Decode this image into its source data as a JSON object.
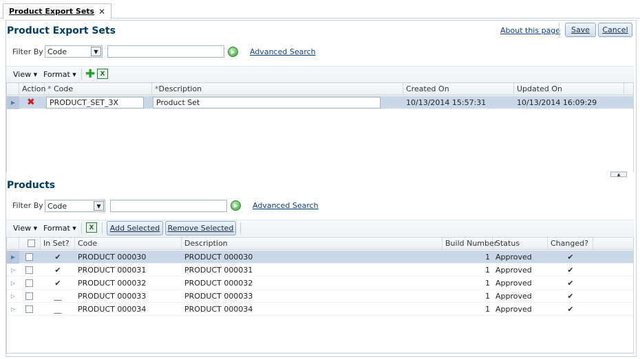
{
  "tab": {
    "label": "Product Export Sets",
    "close": "✕"
  },
  "header": {
    "title": "Product Export Sets",
    "about_link": "About this page",
    "save_label": "Save",
    "cancel_label": "Cancel"
  },
  "filter1": {
    "label": "Filter By",
    "field": "Code",
    "search_value": "",
    "advanced_search": "Advanced Search"
  },
  "toolbar1": {
    "view": "View ▾",
    "format": "Format ▾"
  },
  "export_sets_grid": {
    "columns": [
      "Action",
      "Code",
      "Description",
      "Created On",
      "Updated On"
    ],
    "required_marker": "*",
    "rows": [
      {
        "code": "PRODUCT_SET_3X",
        "description": "Product Set",
        "created_on": "10/13/2014 15:57:31",
        "updated_on": "10/13/2014 16:09:29"
      }
    ]
  },
  "products": {
    "title": "Products",
    "filter": {
      "label": "Filter By",
      "field": "Code",
      "search_value": "",
      "advanced_search": "Advanced Search"
    },
    "toolbar": {
      "view": "View ▾",
      "format": "Format ▾",
      "add_selected": "Add Selected",
      "remove_selected": "Remove Selected"
    },
    "columns": [
      "In Set?",
      "Code",
      "Description",
      "Build Number",
      "Status",
      "Changed?"
    ],
    "rows": [
      {
        "in_set": "✔",
        "code": "PRODUCT 000030",
        "description": "PRODUCT 000030",
        "build": "1",
        "status": "Approved",
        "changed": "✔"
      },
      {
        "in_set": "✔",
        "code": "PRODUCT 000031",
        "description": "PRODUCT 000031",
        "build": "1",
        "status": "Approved",
        "changed": "✔"
      },
      {
        "in_set": "✔",
        "code": "PRODUCT 000032",
        "description": "PRODUCT 000032",
        "build": "1",
        "status": "Approved",
        "changed": "✔"
      },
      {
        "in_set": "__",
        "code": "PRODUCT 000033",
        "description": "PRODUCT 000033",
        "build": "1",
        "status": "Approved",
        "changed": "✔"
      },
      {
        "in_set": "__",
        "code": "PRODUCT 000034",
        "description": "PRODUCT 000034",
        "build": "1",
        "status": "Approved",
        "changed": "✔"
      }
    ]
  },
  "icons": {
    "add": "add-icon",
    "excel": "excel-export-icon",
    "delete": "delete-icon",
    "go": "go-icon",
    "dropdown": "chevron-down-icon",
    "row_pointer": "row-pointer-icon",
    "collapse": "collapse-up-icon"
  },
  "colors": {
    "title": "#003d68",
    "link": "#0a3f8a",
    "selected_row": "#c9d8e8",
    "delete": "#d21f1f",
    "go": "#3aa33a"
  }
}
